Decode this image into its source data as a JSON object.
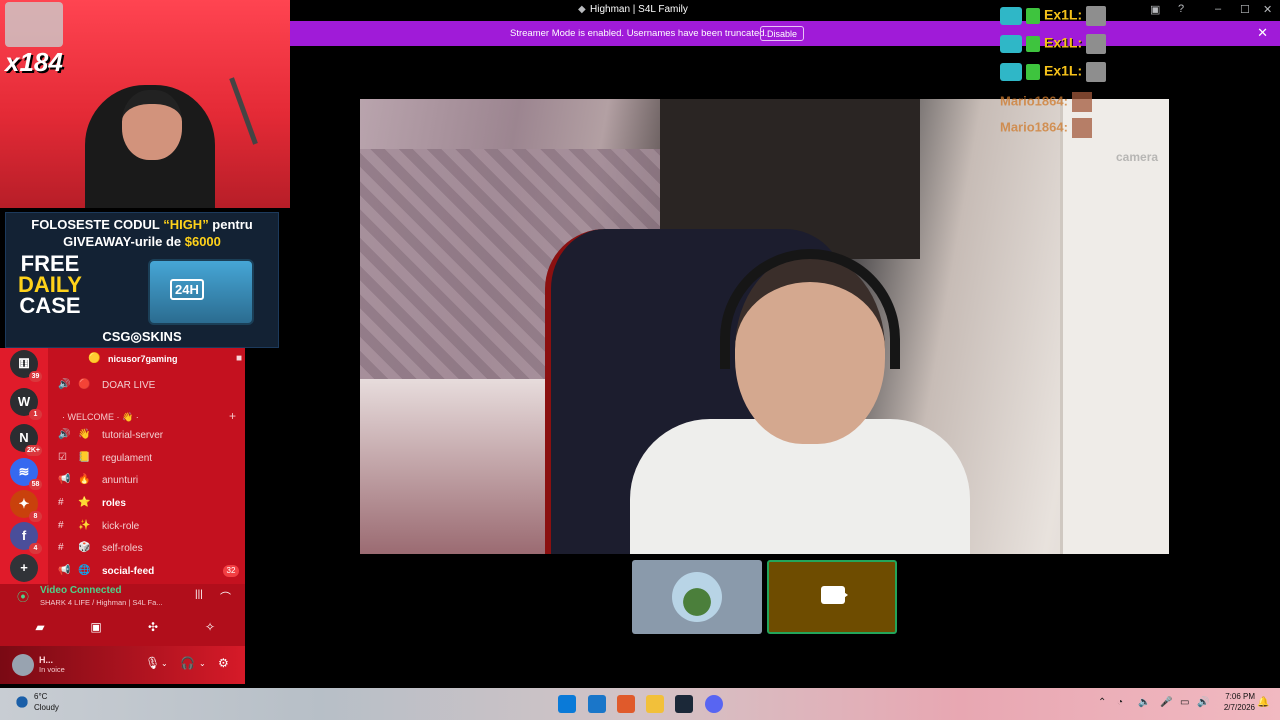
{
  "window": {
    "title": "Highman | S4L Family",
    "controls": {
      "minimize": "–",
      "maximize": "☐",
      "close": "✕"
    }
  },
  "banner": {
    "message": "Streamer Mode is enabled. Usernames have been truncated.",
    "button_label": "Disable",
    "close_label": "✕",
    "color": "#a01bd8"
  },
  "overlay": {
    "alerts": [
      {
        "text": "Ex1L:"
      },
      {
        "text": "Ex1L:"
      },
      {
        "text": "Ex1L:"
      }
    ],
    "faded_alerts": [
      {
        "text": "Mario1864:"
      },
      {
        "text": "Mario1864:"
      }
    ],
    "ghost_text": "camera"
  },
  "webcam": {
    "badge": "x184"
  },
  "promo": {
    "line1_prefix": "FOLOSESTE CODUL ",
    "line1_code": "“HIGH”",
    "line1_suffix": " pentru",
    "line2_prefix": "GIVEAWAY-urile de ",
    "line2_amount": "$6000",
    "free": "FREE",
    "daily": "DAILY",
    "case": "CASE",
    "case_label": "24H",
    "brand": "CSG◎SKINS"
  },
  "servers": [
    {
      "glyph": "⚅",
      "badge": "39"
    },
    {
      "glyph": "W",
      "badge": "1"
    },
    {
      "glyph": "N",
      "badge": "2K+"
    },
    {
      "glyph": "≋",
      "badge": "58"
    },
    {
      "glyph": "✦",
      "badge": "8"
    },
    {
      "glyph": "f",
      "badge": "4"
    },
    {
      "glyph": "+",
      "badge": ""
    }
  ],
  "channels": {
    "top_user": "nicusor7gaming",
    "doar_live": "DOAR LIVE",
    "category": "· WELCOME · 👋 ·",
    "items": [
      {
        "icon": "🔊",
        "emoji": "👋",
        "label": "tutorial-server",
        "bold": false
      },
      {
        "icon": "☑",
        "emoji": "📒",
        "label": "regulament",
        "bold": false
      },
      {
        "icon": "📢",
        "emoji": "🔥",
        "label": "anunturi",
        "bold": false
      },
      {
        "icon": "#",
        "emoji": "⭐",
        "label": "roles",
        "bold": true
      },
      {
        "icon": "#",
        "emoji": "✨",
        "label": "kick-role",
        "bold": false
      },
      {
        "icon": "#",
        "emoji": "🎲",
        "label": "self-roles",
        "bold": false
      },
      {
        "icon": "📢",
        "emoji": "🌐",
        "label": "social-feed",
        "bold": true,
        "badge": "32"
      }
    ]
  },
  "voice": {
    "status": "Video Connected",
    "channel": "SHARK 4 LIFE / Highman | S4L Fa..."
  },
  "user": {
    "name": "H...",
    "status": "In voice"
  },
  "taskbar": {
    "temp": "6°C",
    "condition": "Cloudy",
    "time": "7:06 PM",
    "date": "2/7/2026"
  }
}
